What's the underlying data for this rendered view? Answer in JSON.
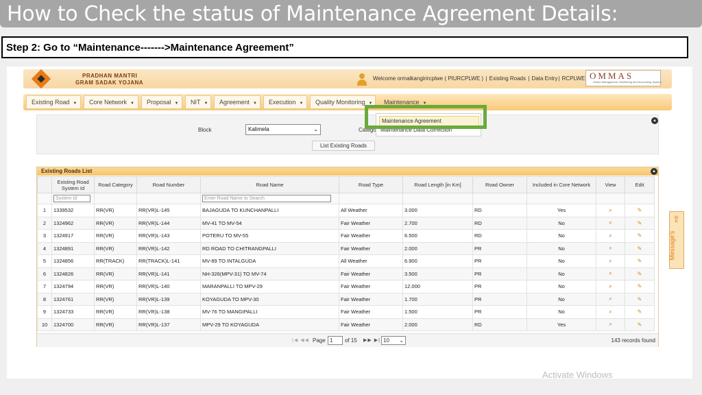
{
  "slide": {
    "title": "How to Check the status of Maintenance Agreement Details:",
    "step": "Step 2: Go to “Maintenance------->Maintenance Agreement”"
  },
  "header": {
    "logo_line1": "PRADHAN MANTRI",
    "logo_line2": "GRAM SADAK YOJANA",
    "welcome": "Welcome ormalkangirircplwe ( PIURCPLWE )",
    "links": [
      "Existing Roads",
      "Data Entry",
      "RCPLWE"
    ],
    "ommas": "OMMAS",
    "ommas_sub": "Online Management, Monitoring and Accounting System"
  },
  "nav": {
    "items": [
      "Existing Road",
      "Core Network",
      "Proposal",
      "NIT",
      "Agreement",
      "Execution",
      "Quality Monitoring",
      "Maintenance"
    ],
    "dropdown": [
      "Maintenance Agreement",
      "Maintenance Data Correction"
    ]
  },
  "search": {
    "block_label": "Block",
    "block_value": "Kalimela",
    "category_label": "Catego",
    "list_button": "List Existing Roads"
  },
  "table": {
    "panel_title": "Existing Roads List",
    "columns": [
      "",
      "Existing Road System Id",
      "Road Category",
      "Road Number",
      "Road Name",
      "Road Type",
      "Road Length [in Km]",
      "Road Owner",
      "Included in Core Network",
      "View",
      "Edit"
    ],
    "filter_system_id": "System Id",
    "filter_road_name": "Enter Road Name to Search",
    "rows": [
      [
        "1",
        "1339532",
        "RR(VR)",
        "RR(VR)L-145",
        "BAJAGUDA TO KUNCHANPALLI",
        "All Weather",
        "3.000",
        "RD",
        "Yes"
      ],
      [
        "2",
        "1324962",
        "RR(VR)",
        "RR(VR)L-144",
        "MV-41 TO MV-54",
        "Fair Weather",
        "2.700",
        "RD",
        "No"
      ],
      [
        "3",
        "1324917",
        "RR(VR)",
        "RR(VR)L-143",
        "POTERU TO MV-55",
        "Fair Weather",
        "6.500",
        "RD",
        "No"
      ],
      [
        "4",
        "1324891",
        "RR(VR)",
        "RR(VR)L-142",
        "RD ROAD TO CHITRANGPALLI",
        "Fair Weather",
        "2.000",
        "PR",
        "No"
      ],
      [
        "5",
        "1324856",
        "RR(TRACK)",
        "RR(TRACK)L-141",
        "MV-89 TO INTALGUDA",
        "All Weather",
        "6.900",
        "PR",
        "No"
      ],
      [
        "6",
        "1324826",
        "RR(VR)",
        "RR(VR)L-141",
        "NH-326(MPV-31) TO MV-74",
        "Fair Weather",
        "3.500",
        "PR",
        "No"
      ],
      [
        "7",
        "1324794",
        "RR(VR)",
        "RR(VR)L-140",
        "MARANPALLI TO MPV-29",
        "Fair Weather",
        "12.000",
        "PR",
        "No"
      ],
      [
        "8",
        "1324761",
        "RR(VR)",
        "RR(VR)L-139",
        "KOYAGUDA TO MPV-30",
        "Fair Weather",
        "1.700",
        "PR",
        "No"
      ],
      [
        "9",
        "1324733",
        "RR(VR)",
        "RR(VR)L-138",
        "MV-76 TO MANGIPALLI",
        "Fair Weather",
        "1.500",
        "PR",
        "No"
      ],
      [
        "10",
        "1324700",
        "RR(VR)",
        "RR(VR)L-137",
        "MPV-29 TO KOYAGUDA",
        "Fair Weather",
        "2.000",
        "RD",
        "Yes"
      ]
    ]
  },
  "pager": {
    "page_label": "Page",
    "page_value": "1",
    "of_label": "of 15",
    "page_size": "10",
    "records": "143 records found"
  },
  "messages_tab": "Message's",
  "watermark": "Activate Windows"
}
